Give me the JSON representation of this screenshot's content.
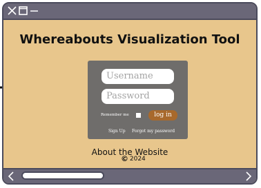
{
  "app": {
    "title": "Whereabouts Visualization Tool"
  },
  "login": {
    "username_placeholder": "Username",
    "password_placeholder": "Password",
    "remember_label": "Remember me",
    "login_button": "log in",
    "signup_link": "Sign Up",
    "forgot_link": "Forgot my password"
  },
  "footer": {
    "about_link": "About the Website",
    "copyright_symbol": "©",
    "year": "2024"
  },
  "colors": {
    "window_bg": "#e8c68c",
    "chrome": "#6a6778",
    "panel": "#6f6d6b",
    "accent": "#a8692c"
  },
  "icons": {
    "window_close": "close-icon",
    "window_maximize": "maximize-icon",
    "window_minimize": "minimize-icon",
    "scroll_left": "chevron-left-icon",
    "scroll_right": "chevron-right-icon",
    "annotation_arrow": "arrow-right-icon"
  }
}
